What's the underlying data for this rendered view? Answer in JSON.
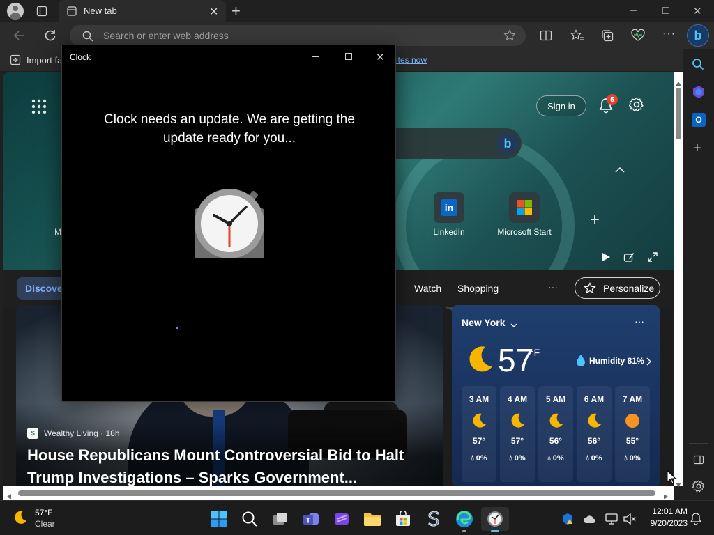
{
  "browser": {
    "tab_title": "New tab",
    "address_placeholder": "Search or enter web address",
    "favorites_bar": {
      "import_label": "Import fa",
      "link_fragment": "ites now"
    }
  },
  "newtab": {
    "sign_in_label": "Sign in",
    "notification_count": "5",
    "left_tile_fragment": "M",
    "quick_links": [
      {
        "label": "LinkedIn",
        "icon": "linkedin-icon"
      },
      {
        "label": "Microsoft Start",
        "icon": "microsoft-start-icon"
      }
    ],
    "feed_tabs": {
      "discover_fragment": "Discove",
      "watch": "Watch",
      "shopping": "Shopping",
      "more": "···",
      "personalize": "Personalize"
    }
  },
  "news": {
    "source": "Wealthy Living · 18h",
    "headline": "House Republicans Mount Controversial Bid to Halt Trump Investigations – Sparks Government..."
  },
  "weather": {
    "city": "New York",
    "temperature": "57",
    "unit": "°F",
    "humidity": "Humidity 81%",
    "more": "···",
    "hourly": [
      {
        "time": "3 AM",
        "icon": "moon-icon",
        "temp": "57°",
        "precip": "0%"
      },
      {
        "time": "4 AM",
        "icon": "moon-icon",
        "temp": "57°",
        "precip": "0%"
      },
      {
        "time": "5 AM",
        "icon": "moon-icon",
        "temp": "56°",
        "precip": "0%"
      },
      {
        "time": "6 AM",
        "icon": "moon-icon",
        "temp": "56°",
        "precip": "0%"
      },
      {
        "time": "7 AM",
        "icon": "sun-icon",
        "temp": "55°",
        "precip": "0%"
      }
    ]
  },
  "clock_app": {
    "title": "Clock",
    "message": "Clock needs an update. We are getting the update ready for you..."
  },
  "taskbar": {
    "weather_temp": "57°F",
    "weather_desc": "Clear",
    "time": "12:01 AM",
    "date": "9/20/2023"
  },
  "colors": {
    "accent": "#4cc2ff",
    "clock_hand_red": "#e0442a",
    "notification_badge": "#e0442a"
  }
}
